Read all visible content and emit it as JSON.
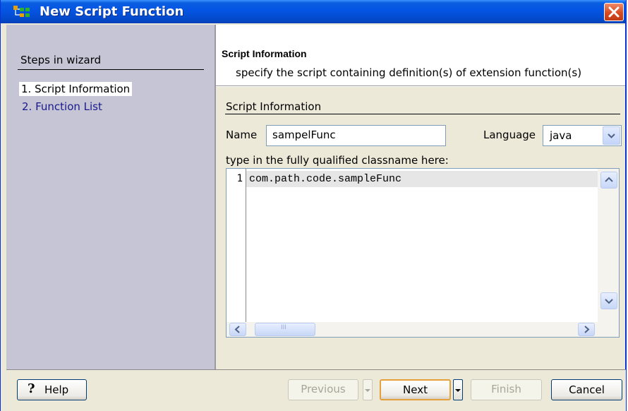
{
  "window": {
    "title": "New Script Function"
  },
  "steps": {
    "heading": "Steps in wizard",
    "items": [
      "1. Script Information",
      "2. Function List"
    ]
  },
  "header": {
    "title": "Script Information",
    "subtitle": "specify the script containing definition(s) of extension function(s)"
  },
  "form": {
    "group_title": "Script Information",
    "name_label": "Name",
    "name_value": "sampelFunc",
    "language_label": "Language",
    "language_value": "java",
    "hint": "type in the fully qualified classname here:"
  },
  "editor": {
    "line_number": "1",
    "code": "com.path.code.sampleFunc",
    "hscroll_thumb_label": "III"
  },
  "buttons": {
    "help": "Help",
    "previous": "Previous",
    "next": "Next",
    "finish": "Finish",
    "cancel": "Cancel"
  },
  "icons": {
    "title_icon": "wizard-tree-icon",
    "close": "close-icon",
    "help": "question-mark-icon"
  },
  "colors": {
    "titlebar": "#0454e3",
    "left_panel": "#c6c5d5",
    "close_button": "#d84a22",
    "default_button_border": "#e5a03c"
  }
}
